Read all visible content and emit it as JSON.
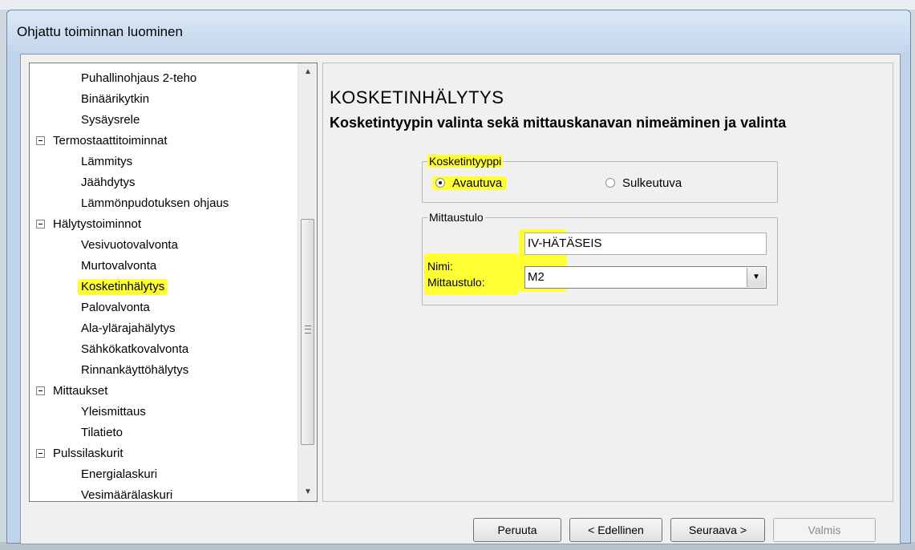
{
  "window": {
    "title": "Ohjattu toiminnan luominen"
  },
  "tree": {
    "items": [
      {
        "label": "Puhallinohjaus 2-teho",
        "level": 1
      },
      {
        "label": "Binäärikytkin",
        "level": 1
      },
      {
        "label": "Sysäysrele",
        "level": 1
      },
      {
        "label": "Termostaattitoiminnat",
        "level": 0
      },
      {
        "label": "Lämmitys",
        "level": 1
      },
      {
        "label": "Jäähdytys",
        "level": 1
      },
      {
        "label": "Lämmönpudotuksen ohjaus",
        "level": 1
      },
      {
        "label": "Hälytystoiminnot",
        "level": 0
      },
      {
        "label": "Vesivuotovalvonta",
        "level": 1
      },
      {
        "label": "Murtovalvonta",
        "level": 1
      },
      {
        "label": "Kosketinhälytys",
        "level": 1,
        "highlighted": true
      },
      {
        "label": "Palovalvonta",
        "level": 1
      },
      {
        "label": "Ala-ylärajahälytys",
        "level": 1
      },
      {
        "label": "Sähkökatkovalvonta",
        "level": 1
      },
      {
        "label": "Rinnankäyttöhälytys",
        "level": 1
      },
      {
        "label": "Mittaukset",
        "level": 0
      },
      {
        "label": "Yleismittaus",
        "level": 1
      },
      {
        "label": "Tilatieto",
        "level": 1
      },
      {
        "label": "Pulssilaskurit",
        "level": 0
      },
      {
        "label": "Energialaskuri",
        "level": 1
      },
      {
        "label": "Vesimäärälaskuri",
        "level": 1
      }
    ]
  },
  "pane": {
    "heading": "KOSKETINHÄLYTYS",
    "subheading": "Kosketintyypin valinta sekä mittauskanavan nimeäminen ja valinta",
    "contact_type": {
      "legend": "Kosketintyyppi",
      "option_open": "Avautuva",
      "option_closed": "Sulkeutuva",
      "selected": "Avautuva"
    },
    "measurement_input": {
      "legend": "Mittaustulo",
      "name_label": "Nimi:",
      "name_value": "IV-HÄTÄSEIS",
      "input_label": "Mittaustulo:",
      "input_value": "M2"
    }
  },
  "buttons": {
    "cancel": "Peruuta",
    "previous": "< Edellinen",
    "next": "Seuraava >",
    "finish": "Valmis"
  },
  "colors": {
    "highlight": "#ffff33",
    "title_bar": "#c3d6ec"
  }
}
